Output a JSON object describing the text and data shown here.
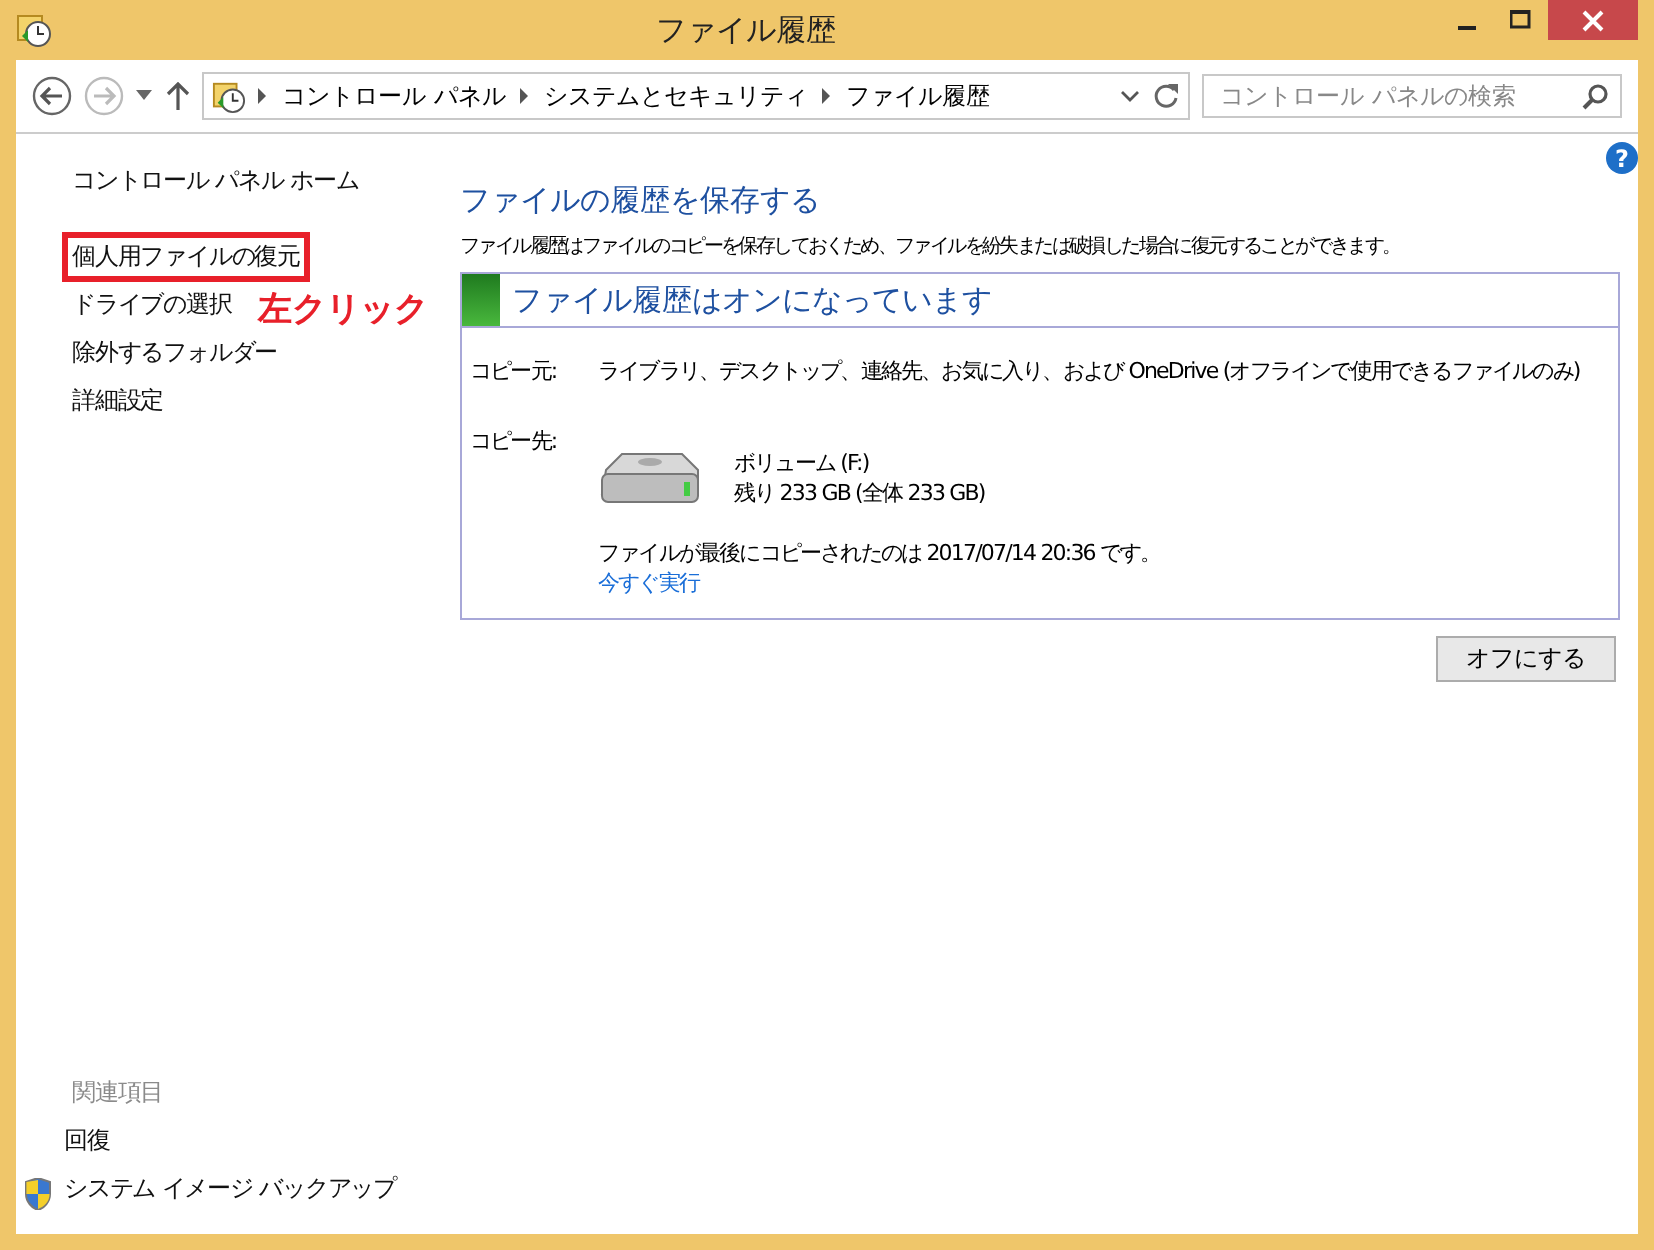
{
  "window": {
    "title": "ファイル履歴"
  },
  "address_bar": {
    "breadcrumbs": [
      "コントロール パネル",
      "システムとセキュリティ",
      "ファイル履歴"
    ],
    "search": {
      "placeholder": "コントロール パネルの検索"
    }
  },
  "sidebar": {
    "items": [
      {
        "label": "コントロール パネル ホーム",
        "highlighted": false
      },
      {
        "label": "個人用ファイルの復元",
        "highlighted": true
      },
      {
        "label": "ドライブの選択",
        "highlighted": false
      },
      {
        "label": "除外するフォルダー",
        "highlighted": false
      },
      {
        "label": "詳細設定",
        "highlighted": false
      }
    ],
    "related": {
      "heading": "関連項目",
      "items": [
        {
          "label": "回復",
          "kind": "plain"
        },
        {
          "label": "システム イメージ バックアップ",
          "kind": "shield"
        }
      ]
    }
  },
  "annotation": {
    "label": "左クリック"
  },
  "main": {
    "help": "?",
    "heading": "ファイルの履歴を保存する",
    "description": "ファイル履歴はファイルのコピーを保存しておくため、ファイルを紛失または破損した場合に復元することができます。",
    "status": {
      "title": "ファイル履歴はオンになっています",
      "on": true
    },
    "copy_from": {
      "label": "コピー元:",
      "value": "ライブラリ、デスクトップ、連絡先、お気に入り、および OneDrive (オフラインで使用できるファイルのみ)"
    },
    "copy_to": {
      "label": "コピー先:",
      "drive_name": "ボリューム (F:)",
      "drive_space": "残り 233 GB (全体 233 GB)"
    },
    "last_copy": "ファイルが最後にコピーされたのは 2017/07/14 20:36 です。",
    "run_now": "今すぐ実行",
    "turn_off_button": "オフにする"
  }
}
